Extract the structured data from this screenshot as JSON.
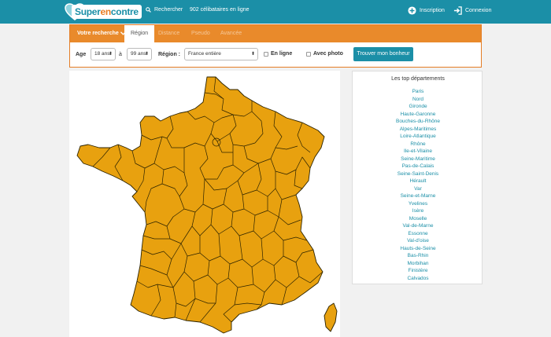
{
  "header": {
    "logo_text_main": "Super",
    "logo_text_accent": "en",
    "logo_text_end": "contre",
    "search_label": "Rechercher",
    "search_icon": "search-icon",
    "online_count": "902 célibataires en ligne",
    "inscription_label": "Inscription",
    "inscription_icon": "plus-circle-icon",
    "connexion_label": "Connexion",
    "connexion_icon": "sign-in-icon"
  },
  "search": {
    "votre_recherche_label": "Votre recherche",
    "tabs": [
      "Région",
      "Distance",
      "Pseudo",
      "Avancée"
    ],
    "active_tab": "Région",
    "age_label": "Age",
    "age_min": "18 ans",
    "age_separator": "à",
    "age_max": "99 ans",
    "region_label": "Région :",
    "region_value": "France entière",
    "online_label": "En ligne",
    "photo_label": "Avec photo",
    "submit_label": "Trouver mon bonheur"
  },
  "map": {
    "fill_color": "#e8a10f",
    "border_color": "#2b2200"
  },
  "top_departments": {
    "title": "Les top départements",
    "items": [
      "Paris",
      "Nord",
      "Gironde",
      "Haute-Garonne",
      "Bouches-du-Rhône",
      "Alpes-Maritimes",
      "Loire-Atlantique",
      "Rhône",
      "Ile-et-Vilaine",
      "Seine-Maritime",
      "Pas-de-Calais",
      "Seine-Saint-Denis",
      "Hérault",
      "Var",
      "Seine-et-Marne",
      "Yvelines",
      "Isère",
      "Moselle",
      "Val-de-Marne",
      "Essonne",
      "Val-d'oise",
      "Hauts-de-Seine",
      "Bas-Rhin",
      "Morbihan",
      "Finistère",
      "Calvados"
    ]
  },
  "colors": {
    "header_bg": "#1b8fa7",
    "orange": "#e98a2b",
    "link": "#1b8fa7"
  }
}
